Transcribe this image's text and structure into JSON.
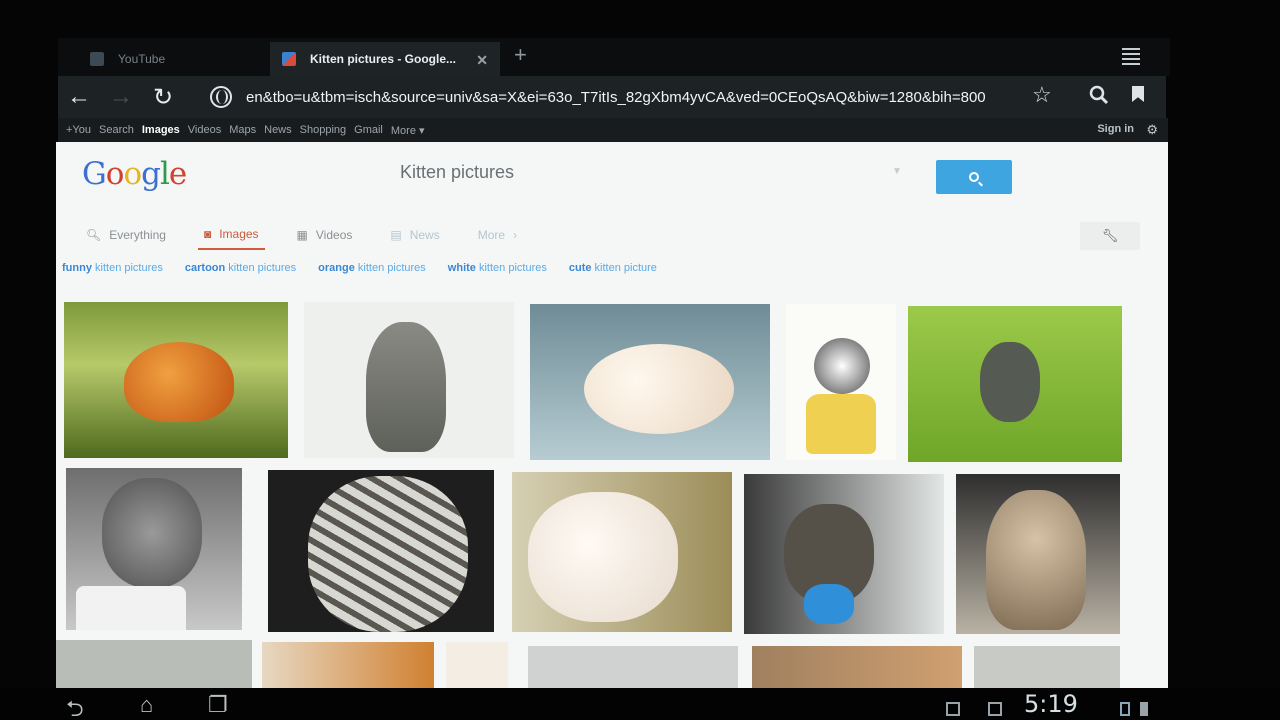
{
  "browser": {
    "tabs": [
      {
        "title": "YouTube",
        "active": false
      },
      {
        "title": "Kitten pictures - Google...",
        "active": true
      }
    ],
    "new_tab": "+",
    "url": "en&tbo=u&tbm=isch&source=univ&sa=X&ei=63o_T7itIs_82gXbm4yvCA&ved=0CEoQsAQ&biw=1280&bih=800"
  },
  "gbar": {
    "links": [
      "+You",
      "Search",
      "Images",
      "Videos",
      "Maps",
      "News",
      "Shopping",
      "Gmail",
      "More ▾"
    ],
    "active": "Images",
    "signin": "Sign in"
  },
  "search": {
    "logo": "Google",
    "query": "Kitten pictures"
  },
  "verticals": [
    {
      "label": "Everything",
      "icon": "search-icon"
    },
    {
      "label": "Images",
      "icon": "camera-icon"
    },
    {
      "label": "Videos",
      "icon": "film-icon"
    },
    {
      "label": "News",
      "icon": "news-icon"
    },
    {
      "label": "More",
      "icon": "chevron-right-icon"
    }
  ],
  "related_searches": [
    {
      "bold": "funny",
      "rest": "kitten pictures"
    },
    {
      "bold": "cartoon",
      "rest": "kitten pictures"
    },
    {
      "bold": "orange",
      "rest": "kitten pictures"
    },
    {
      "bold": "white",
      "rest": "kitten pictures"
    },
    {
      "bold": "cute",
      "rest": "kitten picture"
    }
  ],
  "system": {
    "clock": "5:19"
  },
  "colors": {
    "search_button": "#3ea5e0",
    "active_vertical": "#d35b3d",
    "link": "#3b87d3"
  }
}
